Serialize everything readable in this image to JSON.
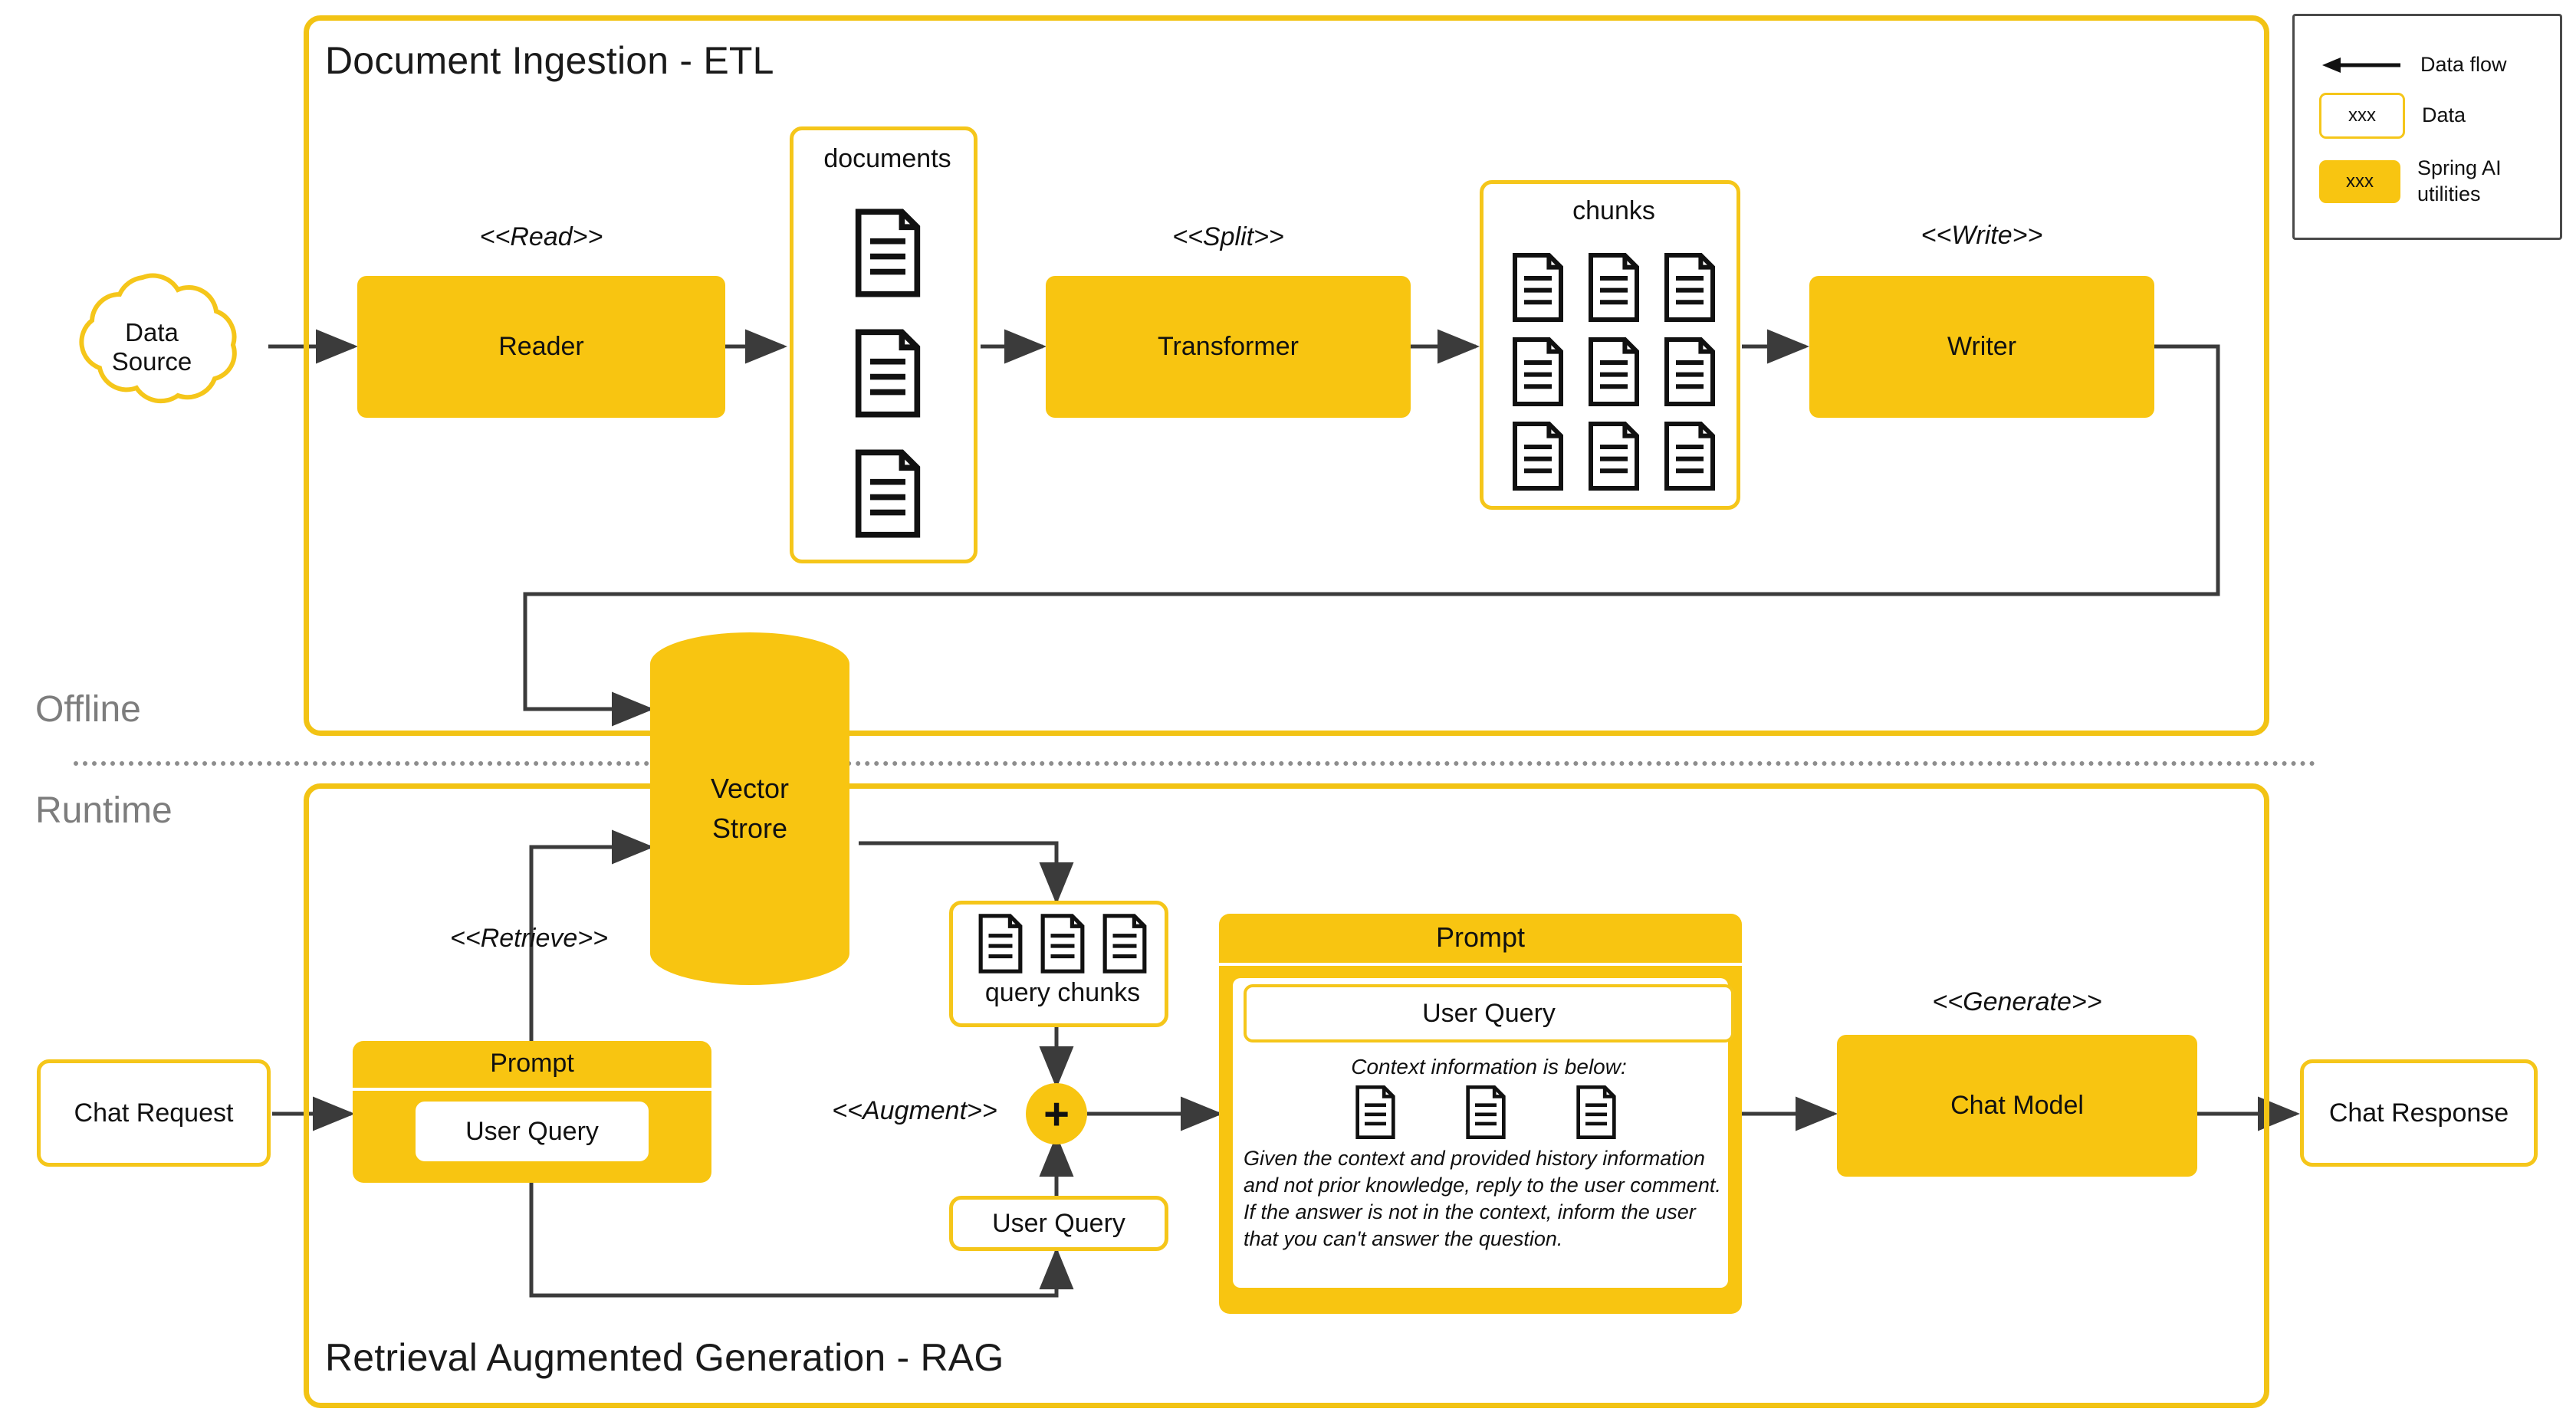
{
  "diagram": {
    "title_etl": "Document Ingestion - ETL",
    "title_rag": "Retrieval Augmented Generation - RAG",
    "phase_offline": "Offline",
    "phase_runtime": "Runtime"
  },
  "legend": {
    "flow_label": "Data flow",
    "data_label": "Data",
    "util_label": "Spring AI utilities",
    "chip_text": "xxx",
    "colors": {
      "accent": "#F8C511",
      "data_border": "#F5C61A",
      "line": "#3b3b3b",
      "phase_text": "#7d7d7d"
    }
  },
  "etl": {
    "source": "Data\nSource",
    "source_line1": "Data",
    "source_line2": "Source",
    "stereo_read": "<<Read>>",
    "reader": "Reader",
    "documents_label": "documents",
    "documents_count": 3,
    "stereo_split": "<<Split>>",
    "transformer": "Transformer",
    "chunks_label": "chunks",
    "chunks_count": 9,
    "stereo_write": "<<Write>>",
    "writer": "Writer"
  },
  "store": {
    "name_line1": "Vector",
    "name_line2": "Strore"
  },
  "rag": {
    "chat_request": "Chat Request",
    "prompt_header": "Prompt",
    "prompt_user_query": "User Query",
    "stereo_retrieve": "<<Retrieve>>",
    "query_chunks_label": "query chunks",
    "query_chunks_count": 3,
    "stereo_augment": "<<Augment>>",
    "plus_symbol": "+",
    "user_query_box": "User Query",
    "big_prompt_header": "Prompt",
    "big_prompt_user_query": "User Query",
    "context_intro": "Context information is below:",
    "context_docs_count": 3,
    "instruction": "Given the context and provided history information and not prior knowledge, reply to the user comment. If the answer is not in the context, inform the user that you can't answer the question.",
    "stereo_generate": "<<Generate>>",
    "chat_model": "Chat Model",
    "chat_response": "Chat Response"
  }
}
